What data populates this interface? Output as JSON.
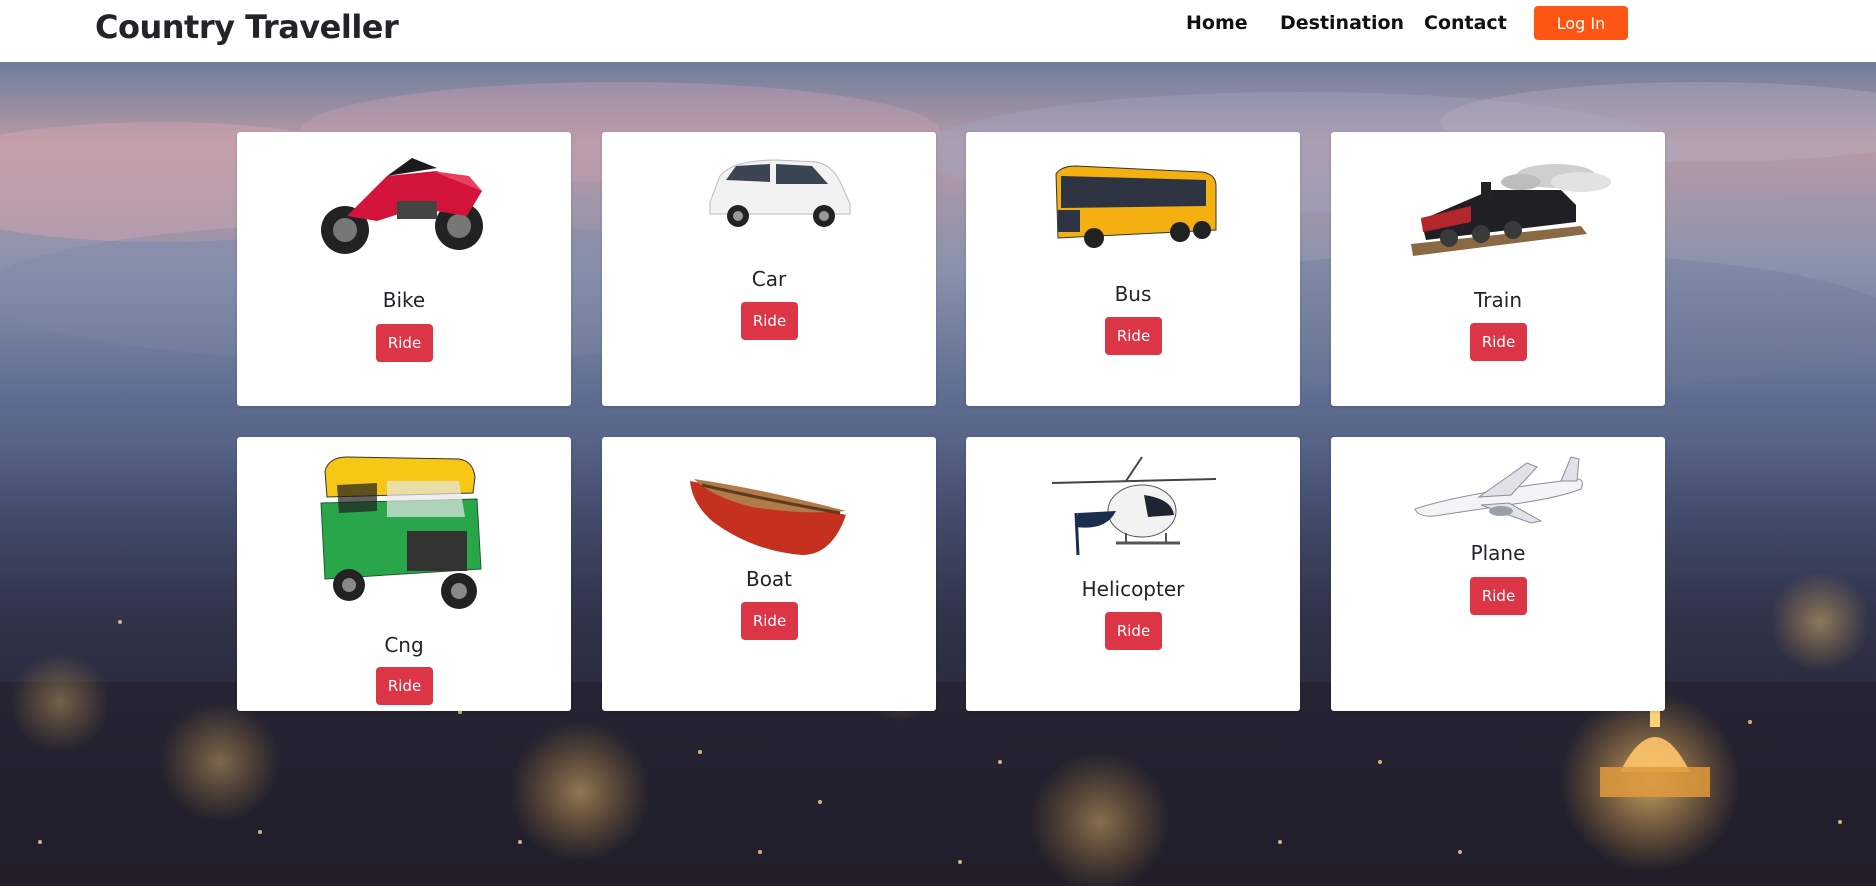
{
  "navbar": {
    "brand": "Country Traveller",
    "links": [
      "Home",
      "Destination",
      "Contact"
    ],
    "login_label": "Log In"
  },
  "vehicles": [
    {
      "title": "Bike",
      "button": "Ride"
    },
    {
      "title": "Car",
      "button": "Ride"
    },
    {
      "title": "Bus",
      "button": "Ride"
    },
    {
      "title": "Train",
      "button": "Ride"
    },
    {
      "title": "Cng",
      "button": "Ride"
    },
    {
      "title": "Boat",
      "button": "Ride"
    },
    {
      "title": "Helicopter",
      "button": "Ride"
    },
    {
      "title": "Plane",
      "button": "Ride"
    }
  ],
  "colors": {
    "login_button": "#fd5513",
    "ride_button": "#dc3545",
    "navbar_bg": "#ffffff",
    "card_bg": "#ffffff"
  }
}
